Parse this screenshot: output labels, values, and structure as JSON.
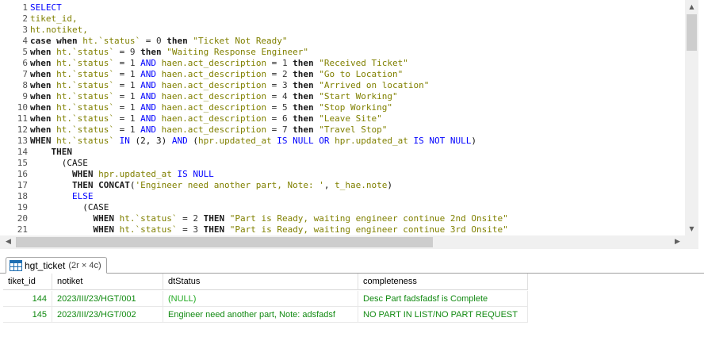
{
  "editor": {
    "lines": [
      {
        "n": "1",
        "t": [
          [
            "kw",
            "SELECT"
          ]
        ]
      },
      {
        "n": "2",
        "t": [
          [
            "id",
            "tiket_id,"
          ]
        ]
      },
      {
        "n": "3",
        "t": [
          [
            "id",
            "ht.notiket,"
          ]
        ]
      },
      {
        "n": "4",
        "t": [
          [
            "kwl",
            "case when "
          ],
          [
            "id",
            "ht.`status`"
          ],
          [
            "op",
            " = "
          ],
          [
            "num",
            "0"
          ],
          [
            "kwl",
            " then "
          ],
          [
            "str",
            "\"Ticket Not Ready\""
          ]
        ]
      },
      {
        "n": "5",
        "t": [
          [
            "kwl",
            "when "
          ],
          [
            "id",
            "ht.`status`"
          ],
          [
            "op",
            " = "
          ],
          [
            "num",
            "9"
          ],
          [
            "kwl",
            " then "
          ],
          [
            "str",
            "\"Waiting Response Engineer\""
          ]
        ]
      },
      {
        "n": "6",
        "t": [
          [
            "kwl",
            "when "
          ],
          [
            "id",
            "ht.`status`"
          ],
          [
            "op",
            " = "
          ],
          [
            "num",
            "1"
          ],
          [
            "kw",
            " AND "
          ],
          [
            "id",
            "haen.act_description"
          ],
          [
            "op",
            " = "
          ],
          [
            "num",
            "1"
          ],
          [
            "kwl",
            " then "
          ],
          [
            "str",
            "\"Received Ticket\""
          ]
        ]
      },
      {
        "n": "7",
        "t": [
          [
            "kwl",
            "when "
          ],
          [
            "id",
            "ht.`status`"
          ],
          [
            "op",
            " = "
          ],
          [
            "num",
            "1"
          ],
          [
            "kw",
            " AND "
          ],
          [
            "id",
            "haen.act_description"
          ],
          [
            "op",
            " = "
          ],
          [
            "num",
            "2"
          ],
          [
            "kwl",
            " then "
          ],
          [
            "str",
            "\"Go to Location\""
          ]
        ]
      },
      {
        "n": "8",
        "t": [
          [
            "kwl",
            "when "
          ],
          [
            "id",
            "ht.`status`"
          ],
          [
            "op",
            " = "
          ],
          [
            "num",
            "1"
          ],
          [
            "kw",
            " AND "
          ],
          [
            "id",
            "haen.act_description"
          ],
          [
            "op",
            " = "
          ],
          [
            "num",
            "3"
          ],
          [
            "kwl",
            " then "
          ],
          [
            "str",
            "\"Arrived on location\""
          ]
        ]
      },
      {
        "n": "9",
        "t": [
          [
            "kwl",
            "when "
          ],
          [
            "id",
            "ht.`status`"
          ],
          [
            "op",
            " = "
          ],
          [
            "num",
            "1"
          ],
          [
            "kw",
            " AND "
          ],
          [
            "id",
            "haen.act_description"
          ],
          [
            "op",
            " = "
          ],
          [
            "num",
            "4"
          ],
          [
            "kwl",
            " then "
          ],
          [
            "str",
            "\"Start Working\""
          ]
        ]
      },
      {
        "n": "10",
        "t": [
          [
            "kwl",
            "when "
          ],
          [
            "id",
            "ht.`status`"
          ],
          [
            "op",
            " = "
          ],
          [
            "num",
            "1"
          ],
          [
            "kw",
            " AND "
          ],
          [
            "id",
            "haen.act_description"
          ],
          [
            "op",
            " = "
          ],
          [
            "num",
            "5"
          ],
          [
            "kwl",
            " then "
          ],
          [
            "str",
            "\"Stop Working\""
          ]
        ]
      },
      {
        "n": "11",
        "t": [
          [
            "kwl",
            "when "
          ],
          [
            "id",
            "ht.`status`"
          ],
          [
            "op",
            " = "
          ],
          [
            "num",
            "1"
          ],
          [
            "kw",
            " AND "
          ],
          [
            "id",
            "haen.act_description"
          ],
          [
            "op",
            " = "
          ],
          [
            "num",
            "6"
          ],
          [
            "kwl",
            " then "
          ],
          [
            "str",
            "\"Leave Site\""
          ]
        ]
      },
      {
        "n": "12",
        "t": [
          [
            "kwl",
            "when "
          ],
          [
            "id",
            "ht.`status`"
          ],
          [
            "op",
            " = "
          ],
          [
            "num",
            "1"
          ],
          [
            "kw",
            " AND "
          ],
          [
            "id",
            "haen.act_description"
          ],
          [
            "op",
            " = "
          ],
          [
            "num",
            "7"
          ],
          [
            "kwl",
            " then "
          ],
          [
            "str",
            "\"Travel Stop\""
          ]
        ]
      },
      {
        "n": "13",
        "t": [
          [
            "kwl",
            "WHEN "
          ],
          [
            "id",
            "ht.`status`"
          ],
          [
            "kw",
            " IN "
          ],
          [
            "pl",
            "(2, 3) "
          ],
          [
            "kw",
            "AND "
          ],
          [
            "pl",
            "("
          ],
          [
            "id",
            "hpr.updated_at"
          ],
          [
            "kw",
            " IS NULL OR "
          ],
          [
            "id",
            "hpr.updated_at"
          ],
          [
            "kw",
            " IS NOT NULL"
          ],
          [
            "pl",
            ")"
          ]
        ]
      },
      {
        "n": "14",
        "t": [
          [
            "pl",
            "    "
          ],
          [
            "kwl",
            "THEN"
          ]
        ]
      },
      {
        "n": "15",
        "t": [
          [
            "pl",
            "      (CASE"
          ]
        ]
      },
      {
        "n": "16",
        "t": [
          [
            "pl",
            "        "
          ],
          [
            "kwl",
            "WHEN "
          ],
          [
            "id",
            "hpr.updated_at"
          ],
          [
            "kw",
            " IS NULL"
          ]
        ]
      },
      {
        "n": "17",
        "t": [
          [
            "pl",
            "        "
          ],
          [
            "kwl",
            "THEN CONCAT"
          ],
          [
            "pl",
            "("
          ],
          [
            "str",
            "'Engineer need another part, Note: '"
          ],
          [
            "pl",
            ", "
          ],
          [
            "id",
            "t_hae.note"
          ],
          [
            "pl",
            ")"
          ]
        ]
      },
      {
        "n": "18",
        "t": [
          [
            "pl",
            "        "
          ],
          [
            "kw",
            "ELSE"
          ]
        ]
      },
      {
        "n": "19",
        "t": [
          [
            "pl",
            "          (CASE"
          ]
        ]
      },
      {
        "n": "20",
        "t": [
          [
            "pl",
            "            "
          ],
          [
            "kwl",
            "WHEN "
          ],
          [
            "id",
            "ht.`status`"
          ],
          [
            "op",
            " = "
          ],
          [
            "num",
            "2"
          ],
          [
            "kwl",
            " THEN "
          ],
          [
            "str",
            "\"Part is Ready, waiting engineer continue 2nd Onsite\""
          ]
        ]
      },
      {
        "n": "21",
        "t": [
          [
            "pl",
            "            "
          ],
          [
            "kwl",
            "WHEN "
          ],
          [
            "id",
            "ht.`status`"
          ],
          [
            "op",
            " = "
          ],
          [
            "num",
            "3"
          ],
          [
            "kwl",
            " THEN "
          ],
          [
            "str",
            "\"Part is Ready, waiting engineer continue 3rd Onsite\""
          ]
        ]
      }
    ]
  },
  "scroll": {
    "up": "▲",
    "down": "▼",
    "left": "◀",
    "right": "▶"
  },
  "results": {
    "tab_label": "hgt_ticket",
    "tab_count": "(2r × 4c)",
    "columns": [
      "tiket_id",
      "notiket",
      "dtStatus",
      "completeness"
    ],
    "rows": [
      [
        "144",
        "2023/III/23/HGT/001",
        "(NULL)",
        "Desc Part fadsfadsf is Complete"
      ],
      [
        "145",
        "2023/III/23/HGT/002",
        "Engineer need another part, Note: adsfadsf",
        "NO PART IN LIST/NO PART REQUEST"
      ]
    ]
  }
}
